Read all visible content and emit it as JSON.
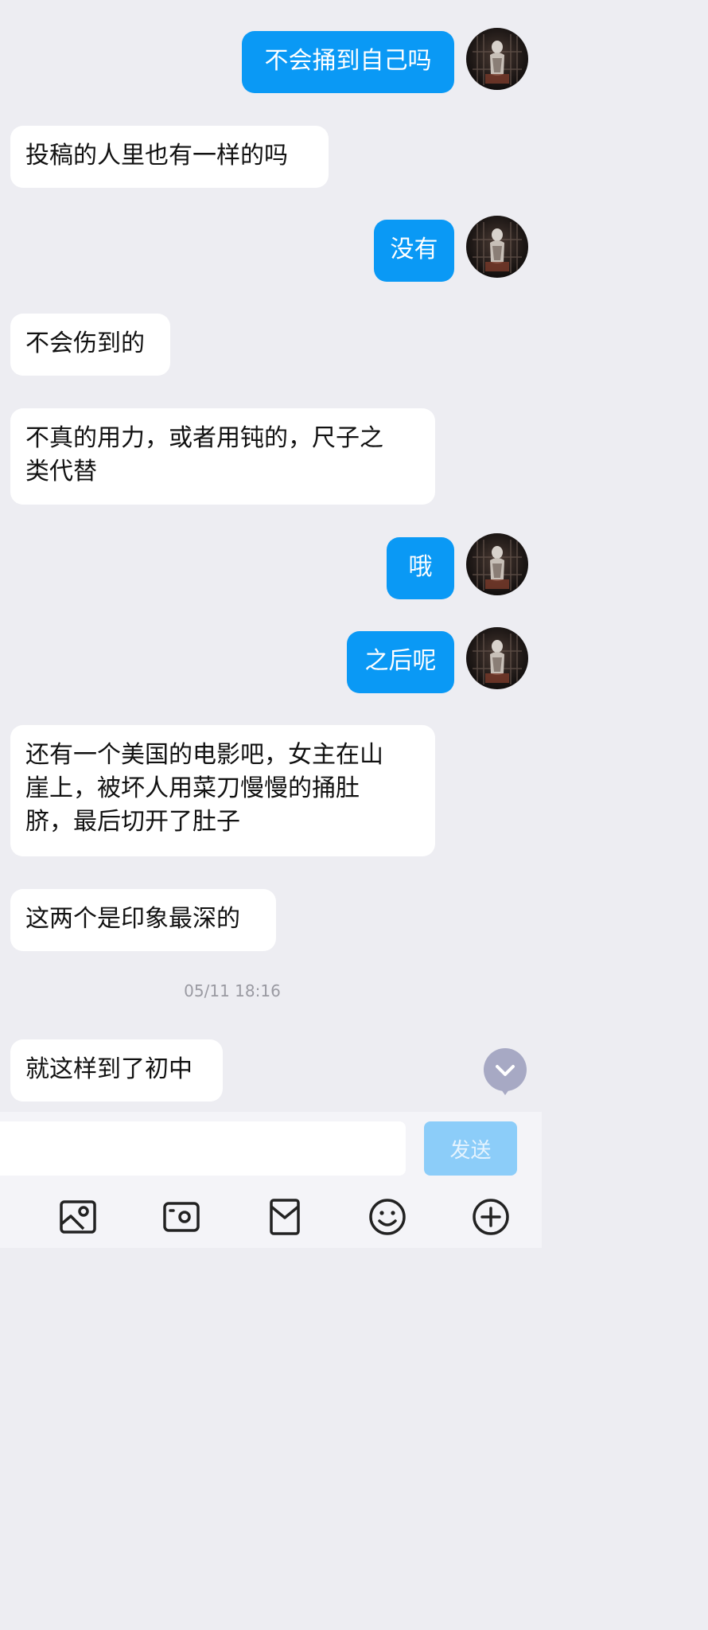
{
  "messages": [
    {
      "side": "right",
      "text": "不会捅到自己吗"
    },
    {
      "side": "left",
      "text": "投稿的人里也有一样的吗"
    },
    {
      "side": "right",
      "text": "没有"
    },
    {
      "side": "left",
      "text": "不会伤到的"
    },
    {
      "side": "left",
      "text": "不真的用力，或者用钝的，尺子之\n类代替"
    },
    {
      "side": "right",
      "text": "哦"
    },
    {
      "side": "right",
      "text": "之后呢"
    },
    {
      "side": "left",
      "text": "还有一个美国的电影吧，女主在山\n崖上，被坏人用菜刀慢慢的捅肚\n脐，最后切开了肚子"
    },
    {
      "side": "left",
      "text": "这两个是印象最深的"
    },
    {
      "side": "left",
      "text": "就这样到了初中"
    }
  ],
  "timestamp": "05/11 18:16",
  "composer": {
    "placeholder": "",
    "send_label": "发送"
  },
  "toolbar": {
    "icons": [
      "image-icon",
      "camera-icon",
      "red-packet-icon",
      "emoji-icon",
      "plus-icon"
    ]
  },
  "colors": {
    "outgoing_bubble": "#0a99f5",
    "incoming_bubble": "#ffffff",
    "background": "#ededf2",
    "send_button_disabled": "#8ccdf9"
  }
}
